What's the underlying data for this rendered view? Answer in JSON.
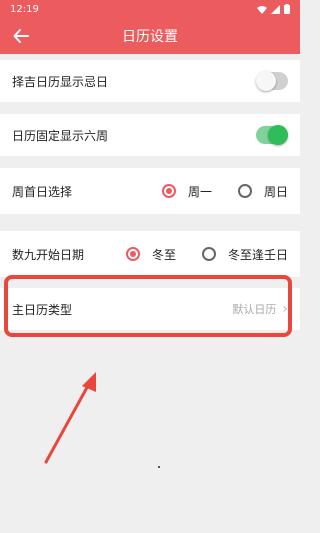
{
  "status_bar": {
    "time": "12:19"
  },
  "app_bar": {
    "title": "日历设置"
  },
  "settings": {
    "show_bad_days": {
      "label": "择吉日历显示忌日",
      "enabled": false
    },
    "fixed_six_weeks": {
      "label": "日历固定显示六周",
      "enabled": true
    },
    "week_start": {
      "label": "周首日选择",
      "options": [
        "周一",
        "周日"
      ],
      "selected": "周一"
    },
    "shujiu_start": {
      "label": "数九开始日期",
      "options": [
        "冬至",
        "冬至逢壬日"
      ],
      "selected": "冬至"
    },
    "main_calendar_type": {
      "label": "主日历类型",
      "value": "默认日历"
    }
  },
  "colors": {
    "accent": "#ec5b5e",
    "toggle_on": "#2ebd59",
    "highlight": "#e8473b"
  },
  "icons": [
    "back-arrow-icon",
    "wifi-icon",
    "signal-icon",
    "battery-icon",
    "chevron-right-icon",
    "annotation-arrow"
  ]
}
